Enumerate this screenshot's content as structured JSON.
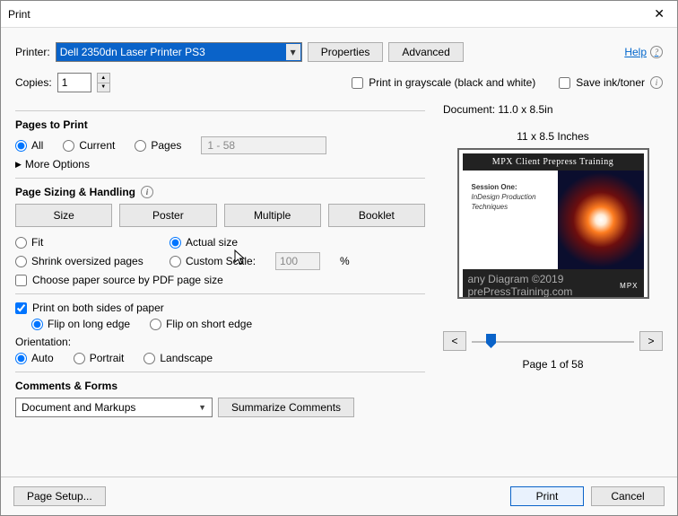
{
  "title": "Print",
  "help_label": "Help",
  "printer": {
    "label": "Printer:",
    "selected": "Dell 2350dn Laser Printer PS3",
    "properties_btn": "Properties",
    "advanced_btn": "Advanced"
  },
  "copies": {
    "label": "Copies:",
    "value": "1"
  },
  "options": {
    "grayscale_label": "Print in grayscale (black and white)",
    "saveink_label": "Save ink/toner"
  },
  "pages": {
    "heading": "Pages to Print",
    "all": "All",
    "current": "Current",
    "pages": "Pages",
    "range": "1 - 58",
    "more": "More Options"
  },
  "sizing": {
    "heading": "Page Sizing & Handling",
    "tabs": {
      "size": "Size",
      "poster": "Poster",
      "multiple": "Multiple",
      "booklet": "Booklet"
    },
    "fit": "Fit",
    "actual": "Actual size",
    "shrink": "Shrink oversized pages",
    "custom": "Custom Scale:",
    "custom_value": "100",
    "percent": "%",
    "choose_source": "Choose paper source by PDF page size",
    "both_sides": "Print on both sides of paper",
    "flip_long": "Flip on long edge",
    "flip_short": "Flip on short edge",
    "orientation_label": "Orientation:",
    "orient_auto": "Auto",
    "orient_portrait": "Portrait",
    "orient_landscape": "Landscape"
  },
  "comments": {
    "heading": "Comments & Forms",
    "selected": "Document and Markups",
    "summarize_btn": "Summarize Comments"
  },
  "preview": {
    "doc_dim": "Document: 11.0 x 8.5in",
    "page_dim": "11 x 8.5 Inches",
    "slide_title": "MPX Client Prepress Training",
    "session_label": "Session One:",
    "session_sub1": "InDesign Production",
    "session_sub2": "Techniques",
    "footer_text": "any Diagram ©2019 prePressTraining.com",
    "brand": "MPX",
    "page_of": "Page 1 of 58",
    "prev": "<",
    "next": ">"
  },
  "footer": {
    "page_setup": "Page Setup...",
    "print": "Print",
    "cancel": "Cancel"
  }
}
